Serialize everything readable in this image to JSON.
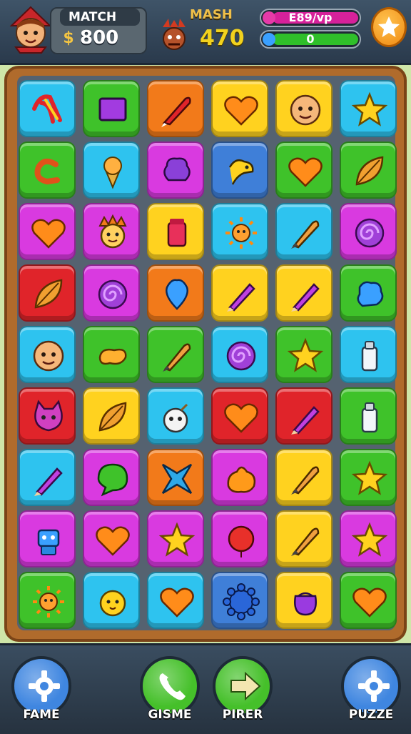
{
  "hud": {
    "match": {
      "label": "MATCH",
      "value": "800",
      "coin_glyph": "$"
    },
    "mash": {
      "label": "MASH",
      "value": "470"
    },
    "bars": [
      {
        "label": "E89/vp",
        "color": "#d6219a",
        "fill_fraction": 1.0,
        "gem_color": "#e63aa8"
      },
      {
        "label": "0",
        "color": "#2fbf2a",
        "fill_fraction": 1.0,
        "gem_color": "#3aa0ff"
      }
    ],
    "icons": [
      "avatar-icon",
      "coin-icon",
      "boss-icon",
      "star-icon"
    ]
  },
  "board": {
    "rows": 9,
    "cols": 6,
    "tiles": [
      [
        "cyan:wishbone",
        "green:square",
        "orange:rocket",
        "yellow:heart",
        "yellow:face",
        "cyan:star"
      ],
      [
        "green:worm",
        "cyan:icecream",
        "magenta:cloud",
        "blue:bird",
        "green:heart",
        "green:leaf"
      ],
      [
        "magenta:heart",
        "magenta:crown-face",
        "yellow:jar",
        "cyan:sun",
        "cyan:brush",
        "magenta:swirl"
      ],
      [
        "red:leaf",
        "magenta:swirl",
        "orange:drop",
        "yellow:pencil",
        "yellow:pencil",
        "green:puzzle"
      ],
      [
        "cyan:face",
        "green:bean",
        "green:brush",
        "cyan:swirl",
        "green:star",
        "cyan:bottle"
      ],
      [
        "red:cat",
        "yellow:leaf",
        "cyan:bomb",
        "red:heart",
        "red:pencil",
        "green:bottle"
      ],
      [
        "cyan:pencil",
        "magenta:bubble",
        "orange:cross",
        "magenta:blob",
        "yellow:brush",
        "green:star"
      ],
      [
        "magenta:robot",
        "magenta:heart",
        "magenta:star",
        "magenta:balloon",
        "yellow:brush",
        "magenta:star"
      ],
      [
        "green:sun",
        "cyan:chick",
        "cyan:heart",
        "blue:gear",
        "yellow:pouch",
        "green:heart"
      ]
    ],
    "palette": {
      "cyan": "#2ec3ef",
      "green": "#3fc22a",
      "orange": "#f27a1a",
      "yellow": "#ffd21f",
      "magenta": "#d93ae0",
      "blue": "#3f7fd8",
      "red": "#e0242a"
    }
  },
  "nav": [
    {
      "label": "FAME",
      "icon": "gear-icon",
      "color": "#3f86e0"
    },
    {
      "label": "GISME",
      "icon": "phone-icon",
      "color": "#45c02a"
    },
    {
      "label": "PIRER",
      "icon": "arrow-icon",
      "color": "#45c02a"
    },
    {
      "label": "PUZZE",
      "icon": "gear-icon",
      "color": "#3f86e0"
    }
  ]
}
